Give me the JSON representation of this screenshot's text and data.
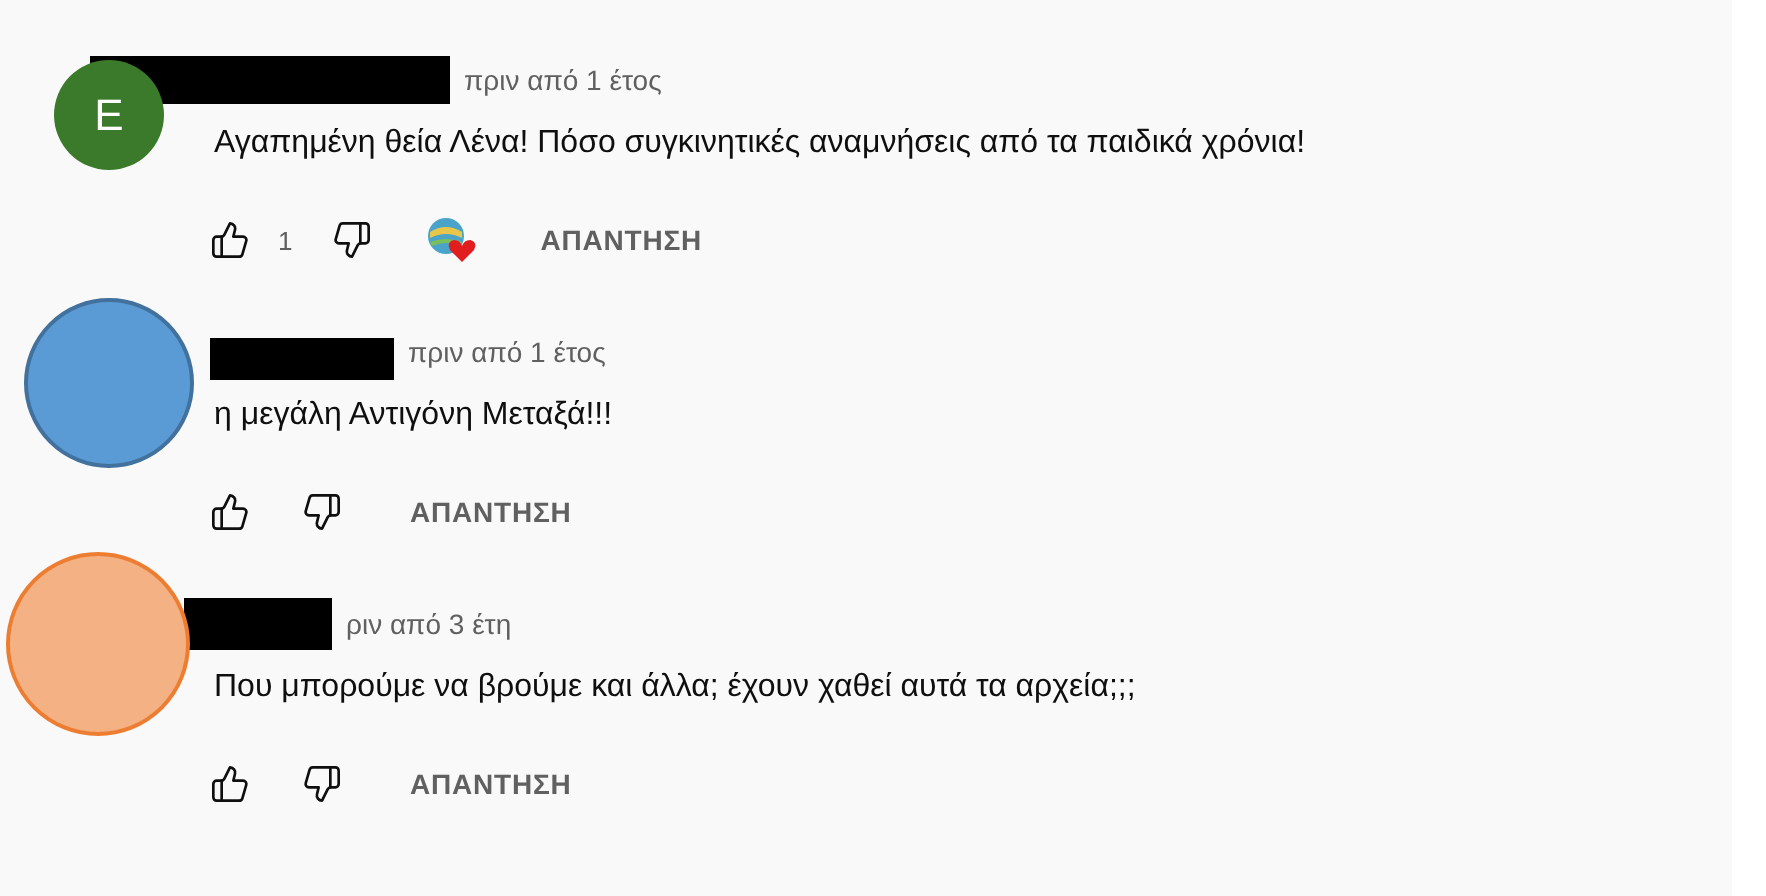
{
  "comments": [
    {
      "avatar": {
        "kind": "letter",
        "letter": "E",
        "color": "#3a7a2a"
      },
      "name_redacted": true,
      "time": "πριν από 1 έτος",
      "text": "Αγαπημένη θεία Λένα! Πόσο συγκινητικές αναμνήσεις από τα παιδικά χρόνια!",
      "likes": "1",
      "creator_heart": true,
      "reply": "ΑΠΑΝΤΗΣΗ"
    },
    {
      "avatar": {
        "kind": "circle",
        "color": "#5b9bd5"
      },
      "name_redacted": true,
      "time": "πριν από 1 έτος",
      "text": "η μεγάλη Αντιγόνη Μεταξά!!!",
      "creator_heart": false,
      "reply": "ΑΠΑΝΤΗΣΗ"
    },
    {
      "avatar": {
        "kind": "circle",
        "color": "#f4b183"
      },
      "name_redacted": true,
      "time": "ριν από 3 έτη",
      "text": "Που μπορούμε να βρούμε και άλλα; έχουν χαθεί αυτά τα αρχεία;;;",
      "creator_heart": false,
      "reply": "ΑΠΑΝΤΗΣΗ"
    }
  ]
}
